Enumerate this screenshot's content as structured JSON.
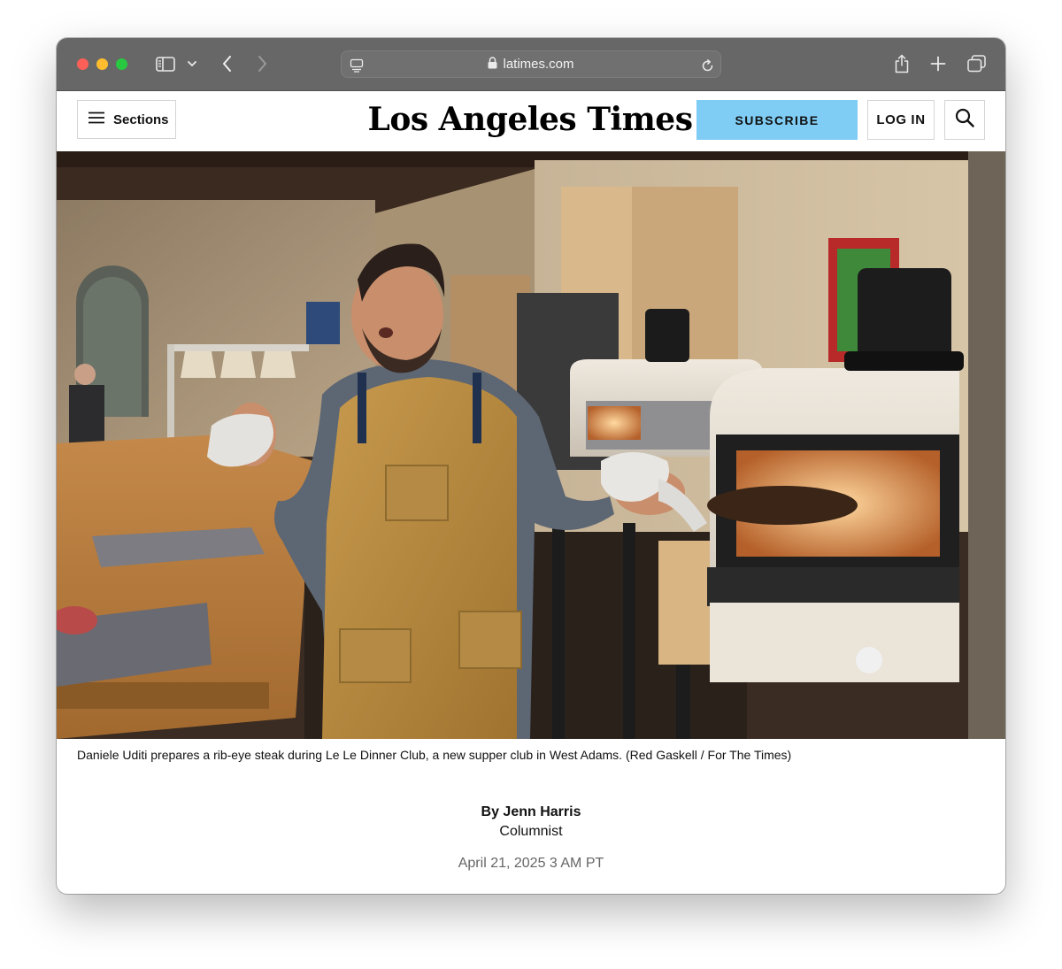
{
  "browser": {
    "url": "latimes.com"
  },
  "site": {
    "sections_label": "Sections",
    "logo_text": "Los Angeles Times",
    "subscribe_label": "SUBSCRIBE",
    "login_label": "LOG IN"
  },
  "article": {
    "photo_caption": "Daniele Uditi prepares a rib-eye steak during Le Le Dinner Club, a new supper club in West Adams. (Red Gaskell / For The Times)",
    "byline": "By Jenn Harris",
    "author_role": "Columnist",
    "dateline": "April 21, 2025 3 AM PT"
  },
  "icons": {
    "sidebar": "sidebar-icon",
    "back": "chevron-left-icon",
    "forward": "chevron-right-icon",
    "share": "share-icon",
    "new_tab": "plus-icon",
    "tabs": "tabs-overview-icon",
    "lock": "lock-icon",
    "reload": "reload-icon",
    "menu": "hamburger-icon",
    "search": "search-icon"
  },
  "colors": {
    "toolbar": "#676767",
    "subscribe": "#7fcdf5",
    "traffic_red": "#fe5f57",
    "traffic_yellow": "#febc2e",
    "traffic_green": "#28c840"
  }
}
